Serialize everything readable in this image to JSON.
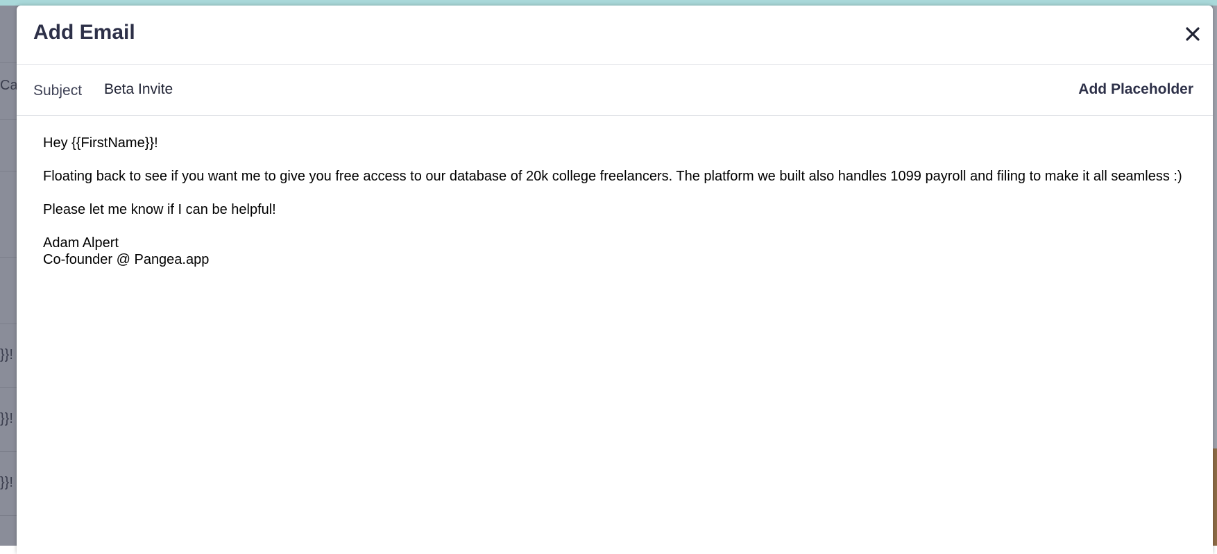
{
  "background": {
    "fragments": [
      "Ca",
      "}}!",
      "}}!",
      "}}!"
    ]
  },
  "modal": {
    "title": "Add Email",
    "close_icon": "close-icon",
    "subject": {
      "label": "Subject",
      "value": "Beta Invite"
    },
    "add_placeholder_label": "Add Placeholder",
    "body": {
      "greeting": "Hey {{FirstName}}!",
      "paragraph_1": "Floating back to see if you want me to give you free access to our database of 20k college freelancers. The platform we built also handles 1099 payroll and filing to make it all seamless :)",
      "paragraph_2": "Please let me know if I can be helpful!",
      "signature_name": "Adam Alpert",
      "signature_title": "Co-founder @ Pangea.app"
    }
  },
  "colors": {
    "title": "#2d3048",
    "divider": "#dfe1e6",
    "overlay": "#8a8d99",
    "top_strip": "#a9d8d9"
  }
}
